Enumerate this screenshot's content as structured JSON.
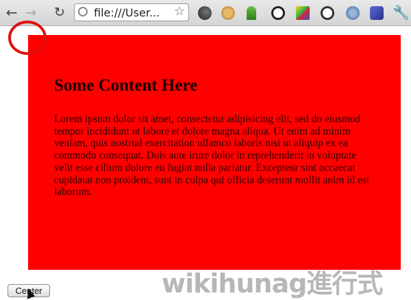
{
  "browser": {
    "back_glyph": "←",
    "forward_glyph": "→",
    "reload_glyph": "↻",
    "url": "file:///User...",
    "bookmark_glyph": "☆",
    "menu_glyph": "🔧",
    "extensions": [
      "dark-extension-icon",
      "cookie-icon",
      "sprout-icon",
      "g-circle-icon",
      "colorful-grid-icon",
      "refresh-circle-icon",
      "globe-icon",
      "palette-icon"
    ]
  },
  "page": {
    "heading": "Some Content Here",
    "body": "Lorem ipsum dolor sit amet, consectetur adipisicing elit, sed do eiusmod tempor incididunt ut labore et dolore magna aliqua. Ut enim ad minim veniam, quis nostrud exercitation ullamco laboris nisi ut aliquip ex ea commodo consequat. Duis aute irure dolor in reprehenderit in voluptate velit esse cillum dolore eu fugiat nulla pariatur. Excepteur sint occaecat cupidatat non proident, sunt in culpa qui officia deserunt mollit anim id est laborum.",
    "box_color": "#ff0000",
    "center_button_label": "Center"
  },
  "annotation": {
    "circle_color": "#e01010"
  },
  "watermark": "wikihunag進行式"
}
